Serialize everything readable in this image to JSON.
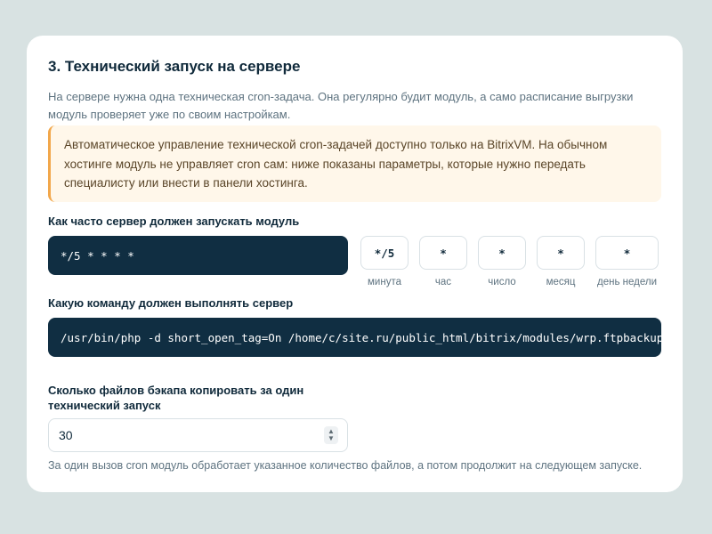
{
  "section": {
    "title": "3. Технический запуск на сервере",
    "intro": "На сервере нужна одна техническая cron-задача. Она регулярно будит модуль, а само расписание выгрузки модуль проверяет уже по своим настройкам.",
    "warning": "Автоматическое управление технической cron-задачей доступно только на BitrixVM. На обычном хостинге модуль не управляет cron сам: ниже показаны параметры, которые нужно передать специалисту или внести в панели хостинга."
  },
  "schedule": {
    "label": "Как часто сервер должен запускать модуль",
    "expression": "*/5 * * * *",
    "fields": [
      {
        "value": "*/5",
        "caption": "минута"
      },
      {
        "value": "*",
        "caption": "час"
      },
      {
        "value": "*",
        "caption": "число"
      },
      {
        "value": "*",
        "caption": "месяц"
      },
      {
        "value": "*",
        "caption": "день недели"
      }
    ]
  },
  "command": {
    "label": "Какую команду должен выполнять сервер",
    "value": "/usr/bin/php -d short_open_tag=On /home/c/site.ru/public_html/bitrix/modules/wrp.ftpbackup/tools/cron.php"
  },
  "files": {
    "label": "Сколько файлов бэкапа копировать за один технический запуск",
    "value": "30",
    "hint": "За один вызов cron модуль обработает указанное количество файлов, а потом продолжит на следующем  запуске."
  },
  "colors": {
    "background": "#d8e2e2",
    "dark_box": "#102e42",
    "warning_bg": "#fff7ea",
    "warning_border": "#f2a74a"
  },
  "icons": {
    "spinner": "number-spinner-icon"
  }
}
